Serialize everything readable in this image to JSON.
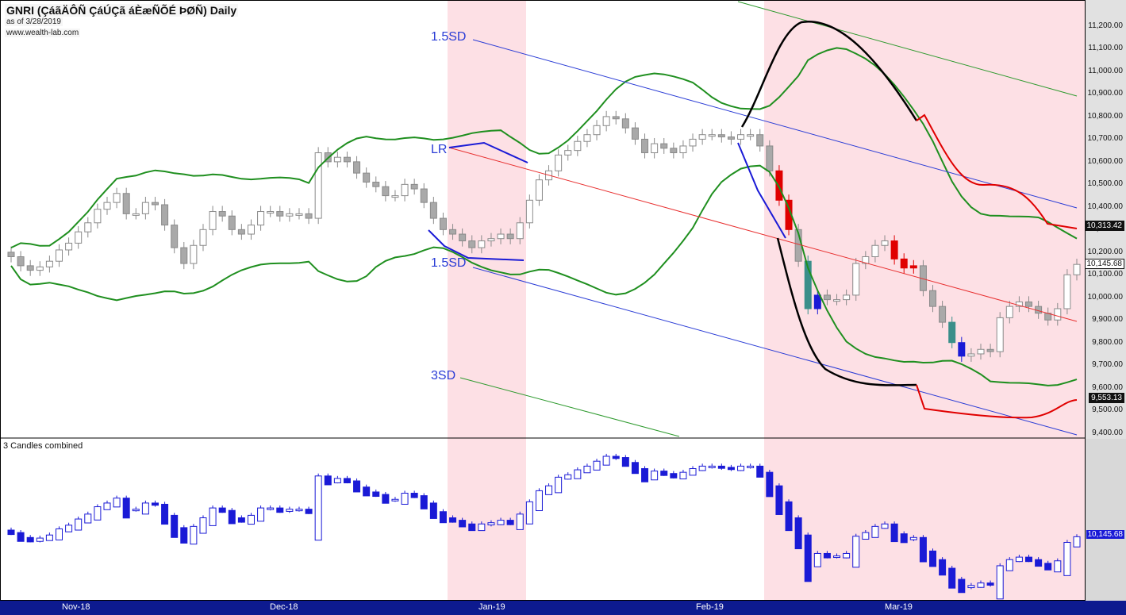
{
  "header": {
    "title": "GNRI (ÇáãÄÔÑ ÇáÚÇã áÈæÑÕÉ ÞØÑ) Daily",
    "as_of": "as of 3/28/2019",
    "site": "www.wealth-lab.com"
  },
  "sub_pane_label": "3 Candles combined",
  "colors": {
    "bull_candle": "#c8c8c8",
    "bear_candle": "#a9a9a9",
    "red_candle": "#e00000",
    "teal_candle": "#3a8f8a",
    "blue_candle": "#1a1ad6",
    "regression_line": "#e83030",
    "sd_line": "#2a3cd6",
    "sd3_line": "#2e9a2e",
    "bands": "#1f8f1f",
    "shade": "#fde0e5",
    "axis_bar": "#0d1a8f",
    "price_panel": "#e1e1e1"
  },
  "chart_data": [
    {
      "type": "candlestick",
      "title": "GNRI (ÇáãÄÔÑ ÇáÚÇã áÈæÑÕÉ ÞØÑ) Daily",
      "x_labels": [
        "Nov-18",
        "Dec-18",
        "Jan-19",
        "Feb-19",
        "Mar-19"
      ],
      "y_ticks": [
        "11,200.00",
        "11,100.00",
        "11,000.00",
        "10,900.00",
        "10,800.00",
        "10,700.00",
        "10,600.00",
        "10,500.00",
        "10,400.00",
        "10,300.00",
        "10,200.00",
        "10,100.00",
        "10,000.00",
        "9,900.00",
        "9,800.00",
        "9,700.00",
        "9,600.00",
        "9,500.00",
        "9,400.00"
      ],
      "ylim": [
        9400,
        11250
      ],
      "price_labels": [
        {
          "text": "10,313.42",
          "value": 10313.42,
          "style": "dark"
        },
        {
          "text": "10,145.68",
          "value": 10145.68,
          "style": "light"
        },
        {
          "text": "9,553.13",
          "value": 9553.13,
          "style": "dark"
        }
      ],
      "level_labels": [
        {
          "text": "1.5SD",
          "value": 11200
        },
        {
          "text": "LR",
          "value": 10675
        },
        {
          "text": "1.5SD",
          "value": 10150
        },
        {
          "text": "3SD",
          "value": 9625
        }
      ],
      "shaded_periods": [
        [
          "Dec-27",
          "Jan-10"
        ],
        [
          "Feb-11",
          "Mar-28"
        ]
      ],
      "closes": [
        10180,
        10140,
        10120,
        10135,
        10160,
        10210,
        10240,
        10290,
        10330,
        10390,
        10420,
        10460,
        10370,
        10370,
        10420,
        10410,
        10320,
        10220,
        10150,
        10230,
        10300,
        10380,
        10360,
        10300,
        10280,
        10320,
        10380,
        10380,
        10360,
        10370,
        10370,
        10350,
        10640,
        10600,
        10620,
        10600,
        10550,
        10510,
        10490,
        10450,
        10450,
        10500,
        10480,
        10420,
        10350,
        10300,
        10280,
        10250,
        10220,
        10250,
        10260,
        10280,
        10260,
        10330,
        10430,
        10520,
        10560,
        10630,
        10650,
        10690,
        10720,
        10760,
        10800,
        10790,
        10750,
        10700,
        10640,
        10680,
        10660,
        10640,
        10670,
        10700,
        10720,
        10720,
        10710,
        10700,
        10720,
        10720,
        10670,
        10560,
        10430,
        10300,
        10160,
        9950,
        10010,
        9990,
        9990,
        10010,
        10150,
        10180,
        10230,
        10250,
        10170,
        10130,
        10140,
        10030,
        9960,
        9890,
        9800,
        9740,
        9750,
        9770,
        9760,
        9910,
        9960,
        9980,
        9960,
        9930,
        9900,
        9950,
        10100,
        10146
      ],
      "lines": [
        {
          "name": "upper-band",
          "color": "#1f8f1f"
        },
        {
          "name": "lower-band",
          "color": "#1f8f1f"
        },
        {
          "name": "regression",
          "color": "#e83030"
        }
      ]
    },
    {
      "type": "candlestick",
      "title": "3 Candles combined",
      "price_label": {
        "text": "10,145.68",
        "value": 10145.68
      }
    }
  ]
}
